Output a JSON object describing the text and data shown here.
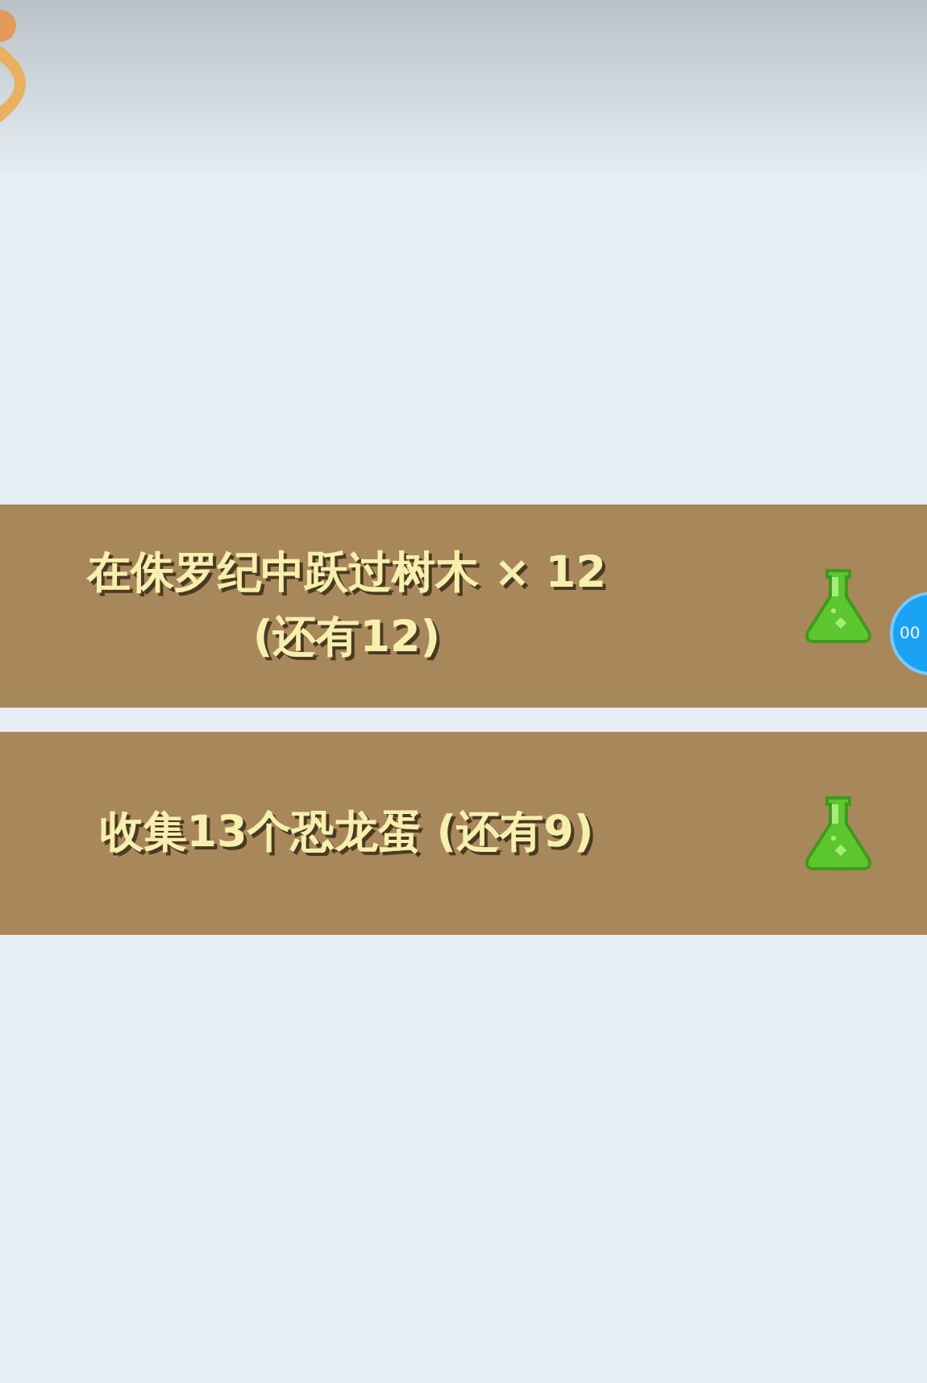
{
  "missions": [
    {
      "lines": [
        "在侏罗纪中跃过树木 × 12",
        "(还有12)"
      ]
    },
    {
      "lines": [
        "收集13个恐龙蛋 (还有9)"
      ]
    }
  ],
  "floating_bubble": {
    "label": "00"
  }
}
